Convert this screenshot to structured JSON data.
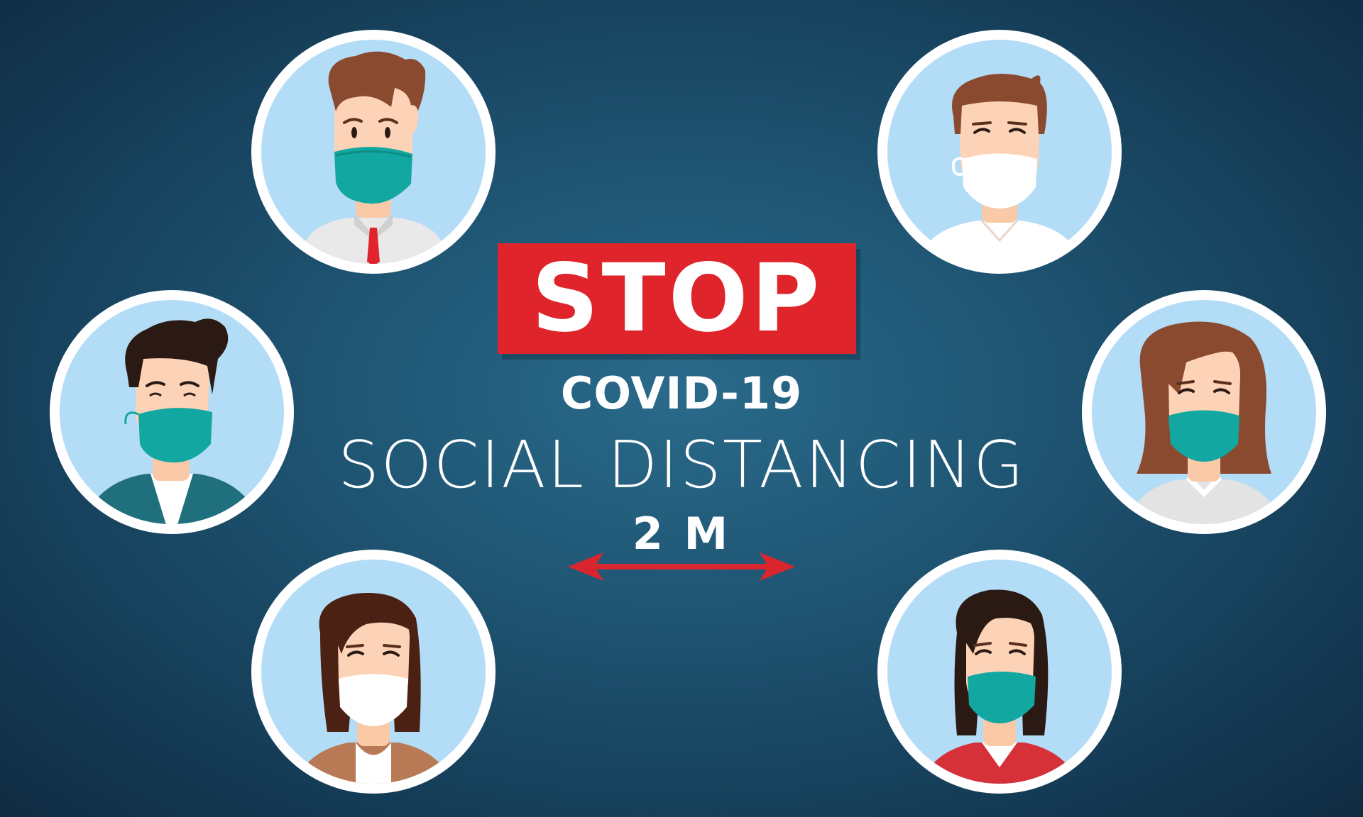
{
  "poster": {
    "headline": "STOP",
    "subheadline": "COVID-19",
    "message": "SOCIAL DISTANCING",
    "distance": "2 M"
  },
  "colors": {
    "background": "#1f5674",
    "circle_fill": "#b3dcf7",
    "circle_ring": "#ffffff",
    "stop_red": "#e0242c",
    "arrow_red": "#d9262e",
    "mask_teal": "#12a7a0",
    "mask_white": "#ffffff"
  },
  "people": [
    {
      "role": "man-businessman-teal-mask"
    },
    {
      "role": "man-casual-white-mask"
    },
    {
      "role": "man-casual-teal-mask"
    },
    {
      "role": "woman-blouse-teal-mask"
    },
    {
      "role": "woman-jacket-white-mask"
    },
    {
      "role": "woman-red-top-teal-mask"
    }
  ],
  "icons": {
    "arrow": "double-headed-arrow-icon"
  }
}
